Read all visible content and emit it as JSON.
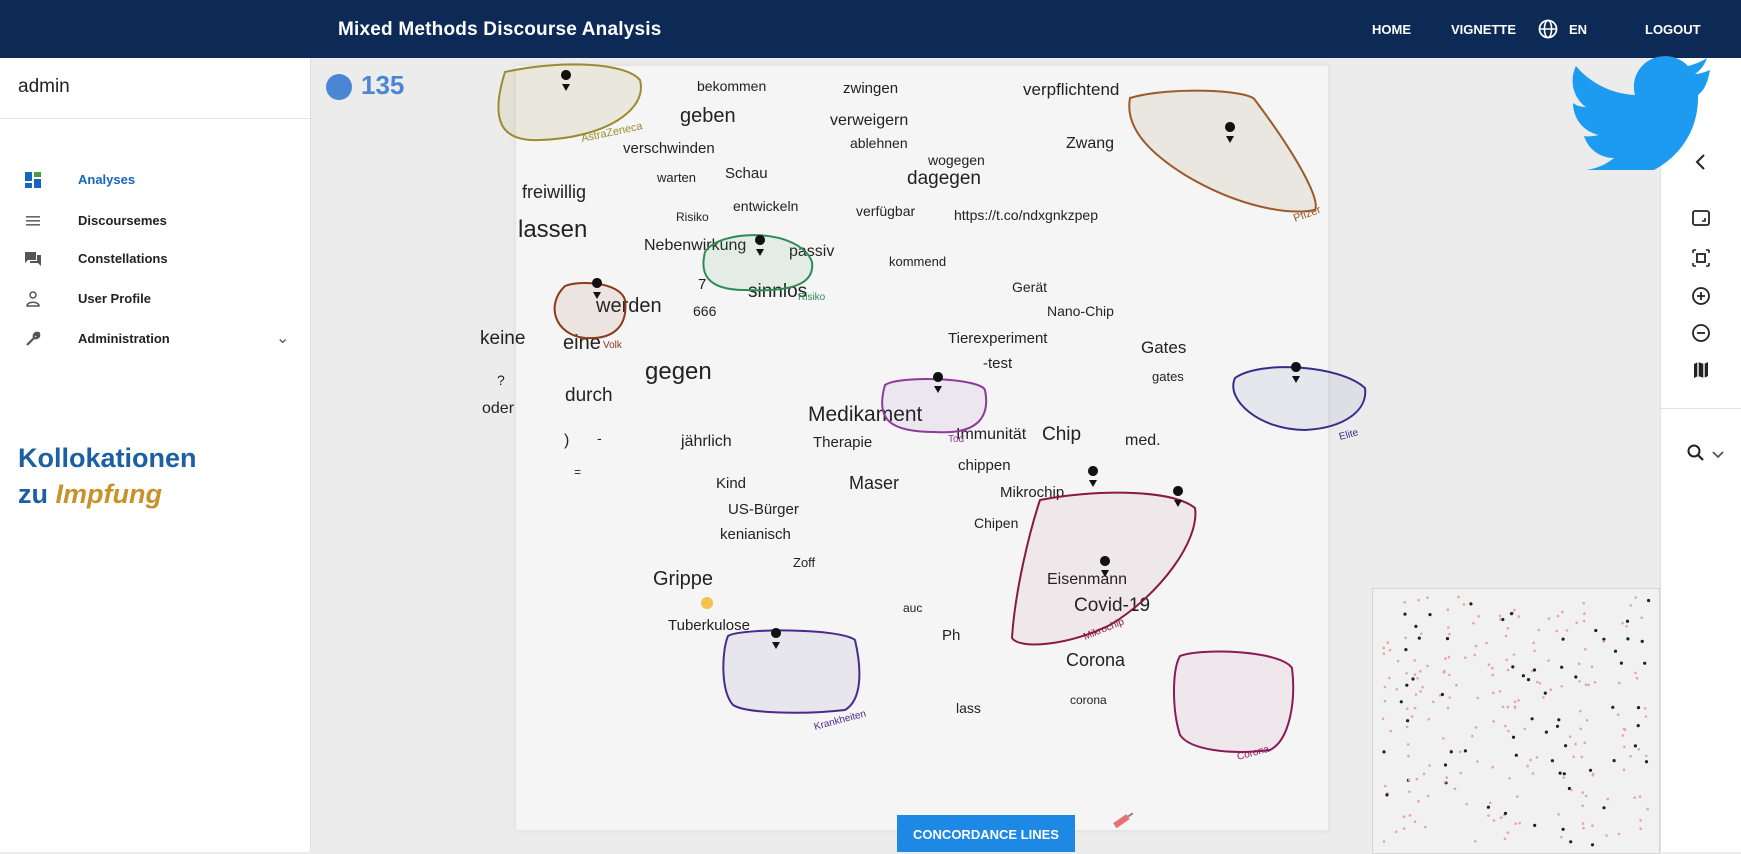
{
  "app": {
    "title": "Mixed Methods Discourse Analysis",
    "nav": {
      "home": "HOME",
      "vignette": "VIGNETTE",
      "lang": "EN",
      "logout": "LOGOUT"
    }
  },
  "sidebar": {
    "user": "admin",
    "items": [
      {
        "label": "Analyses",
        "icon": "dashboard-icon",
        "active": true
      },
      {
        "label": "Discoursemes",
        "icon": "list-icon"
      },
      {
        "label": "Constellations",
        "icon": "chat-icon"
      },
      {
        "label": "User Profile",
        "icon": "person-icon"
      },
      {
        "label": "Administration",
        "icon": "wrench-icon"
      }
    ]
  },
  "heading": {
    "line1": "Kollokationen",
    "prefix": "zu ",
    "term": "Impfung"
  },
  "count": "135",
  "words": [
    {
      "t": "bekommen",
      "s": 14
    },
    {
      "t": "zwingen",
      "s": 15
    },
    {
      "t": "verpflichtend",
      "s": 17
    },
    {
      "t": "geben",
      "s": 20
    },
    {
      "t": "verweigern",
      "s": 16
    },
    {
      "t": "verschwinden",
      "s": 15
    },
    {
      "t": "ablehnen",
      "s": 14
    },
    {
      "t": "Zwang",
      "s": 16
    },
    {
      "t": "wogegen",
      "s": 14
    },
    {
      "t": "warten",
      "s": 13
    },
    {
      "t": "Schau",
      "s": 15
    },
    {
      "t": "dagegen",
      "s": 19
    },
    {
      "t": "freiwillig",
      "s": 18
    },
    {
      "t": "entwickeln",
      "s": 14
    },
    {
      "t": "verfügbar",
      "s": 14
    },
    {
      "t": "https://t.co/ndxgnkzpep",
      "s": 14
    },
    {
      "t": "Risiko",
      "s": 12
    },
    {
      "t": "lassen",
      "s": 24
    },
    {
      "t": "Nebenwirkung",
      "s": 16
    },
    {
      "t": "passiv",
      "s": 16
    },
    {
      "t": "kommend",
      "s": 13
    },
    {
      "t": "7",
      "s": 15
    },
    {
      "t": "sinnlos",
      "s": 19
    },
    {
      "t": "Gerät",
      "s": 14
    },
    {
      "t": "werden",
      "s": 20
    },
    {
      "t": "666",
      "s": 14
    },
    {
      "t": "Nano-Chip",
      "s": 14
    },
    {
      "t": "keine",
      "s": 19
    },
    {
      "t": "eine",
      "s": 20
    },
    {
      "t": "Tierexperiment",
      "s": 15
    },
    {
      "t": "Gates",
      "s": 17
    },
    {
      "t": "-test",
      "s": 15
    },
    {
      "t": "gates",
      "s": 13
    },
    {
      "t": "?",
      "s": 14
    },
    {
      "t": "gegen",
      "s": 24
    },
    {
      "t": "durch",
      "s": 19
    },
    {
      "t": "oder",
      "s": 16
    },
    {
      "t": "Medikament",
      "s": 21
    },
    {
      "t": "Immunität",
      "s": 16
    },
    {
      "t": "med.",
      "s": 16
    },
    {
      "t": ")",
      "s": 16
    },
    {
      "t": "-",
      "s": 14
    },
    {
      "t": "jährlich",
      "s": 16
    },
    {
      "t": "Therapie",
      "s": 15
    },
    {
      "t": "Chip",
      "s": 19
    },
    {
      "t": "=",
      "s": 12
    },
    {
      "t": "chippen",
      "s": 15
    },
    {
      "t": "Kind",
      "s": 15
    },
    {
      "t": "Maser",
      "s": 18
    },
    {
      "t": "Mikrochip",
      "s": 15
    },
    {
      "t": "US-Bürger",
      "s": 15
    },
    {
      "t": "Chipen",
      "s": 14
    },
    {
      "t": "kenianisch",
      "s": 15
    },
    {
      "t": "Zoff",
      "s": 13
    },
    {
      "t": "Grippe",
      "s": 20
    },
    {
      "t": "Eisenmann",
      "s": 16
    },
    {
      "t": "Covid-19",
      "s": 19
    },
    {
      "t": "auc",
      "s": 12
    },
    {
      "t": "Tuberkulose",
      "s": 15
    },
    {
      "t": "Ph",
      "s": 15
    },
    {
      "t": "Corona",
      "s": 18
    },
    {
      "t": "corona",
      "s": 12
    },
    {
      "t": "lass",
      "s": 14
    }
  ],
  "hull_labels": {
    "astrazeneca": "AstraZeneca",
    "pfizer": "Pfizer",
    "risiko": "Risiko",
    "volk": "Volk",
    "tod": "Tod",
    "elite": "Elite",
    "mikrochip": "Mikrochip",
    "krankheiten": "Krankheiten",
    "corona": "Corona"
  },
  "concordance_button": "CONCORDANCE LINES",
  "colors": {
    "topbar": "#0d2a57",
    "accent": "#1e88e5",
    "heading": "#1d5fa5",
    "term": "#c8922a",
    "twitter": "#1d9bf0"
  }
}
